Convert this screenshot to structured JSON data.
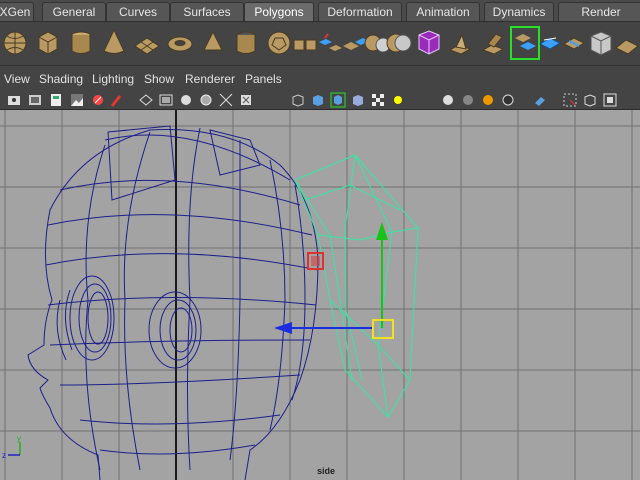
{
  "shelf_tabs": [
    {
      "label": "XGen"
    },
    {
      "label": "General"
    },
    {
      "label": "Curves"
    },
    {
      "label": "Surfaces"
    },
    {
      "label": "Polygons",
      "active": true
    },
    {
      "label": "Deformation"
    },
    {
      "label": "Animation"
    },
    {
      "label": "Dynamics"
    },
    {
      "label": "Render"
    }
  ],
  "shelf_icons": [
    "sphere-icon",
    "cube-icon",
    "cylinder-icon",
    "cone-icon",
    "plane-icon",
    "torus-icon",
    "prism-icon",
    "pipe-icon",
    "soccer-ball-icon",
    "combine-icon",
    "separate-icon",
    "extract-icon",
    "smooth-icon",
    "boolean-icon",
    "mirror-icon",
    "extrude-icon",
    "bridge-icon",
    "append-icon",
    "split-icon",
    "insert-loop-icon",
    "offset-loop-icon",
    "bevel-icon"
  ],
  "panel_menu": [
    "View",
    "Shading",
    "Lighting",
    "Show",
    "Renderer",
    "Panels"
  ],
  "panel_tools": [
    "select-camera-icon",
    "camera-attributes-icon",
    "bookmark-icon",
    "image-plane-icon",
    "2d-pan-zoom-icon",
    "grease-pencil-icon",
    "grid-icon",
    "film-gate-icon",
    "resolution-gate-icon",
    "gate-mask-icon",
    "field-chart-icon",
    "safe-action-icon",
    "wireframe-icon",
    "smooth-shade-icon",
    "wireframe-on-shaded-icon",
    "textured-icon",
    "use-all-lights-icon",
    "shadows-icon",
    "screen-space-ao-icon",
    "motion-blur-icon",
    "multisample-aa-icon",
    "depth-of-field-icon",
    "isolate-select-icon",
    "xray-icon",
    "xray-joints-icon",
    "xray-active-icon"
  ],
  "viewport": {
    "label": "side",
    "colors": {
      "background": "#a3a3a3",
      "grid": "#6e6e6e",
      "axis": "#222222",
      "head_wire": "#1a1e8a",
      "selected_wire": "#2ee8a8",
      "move_y": "#19c219",
      "move_z": "#1a2ee0",
      "pivot": "#f0e020",
      "marker": "#e03030"
    }
  }
}
